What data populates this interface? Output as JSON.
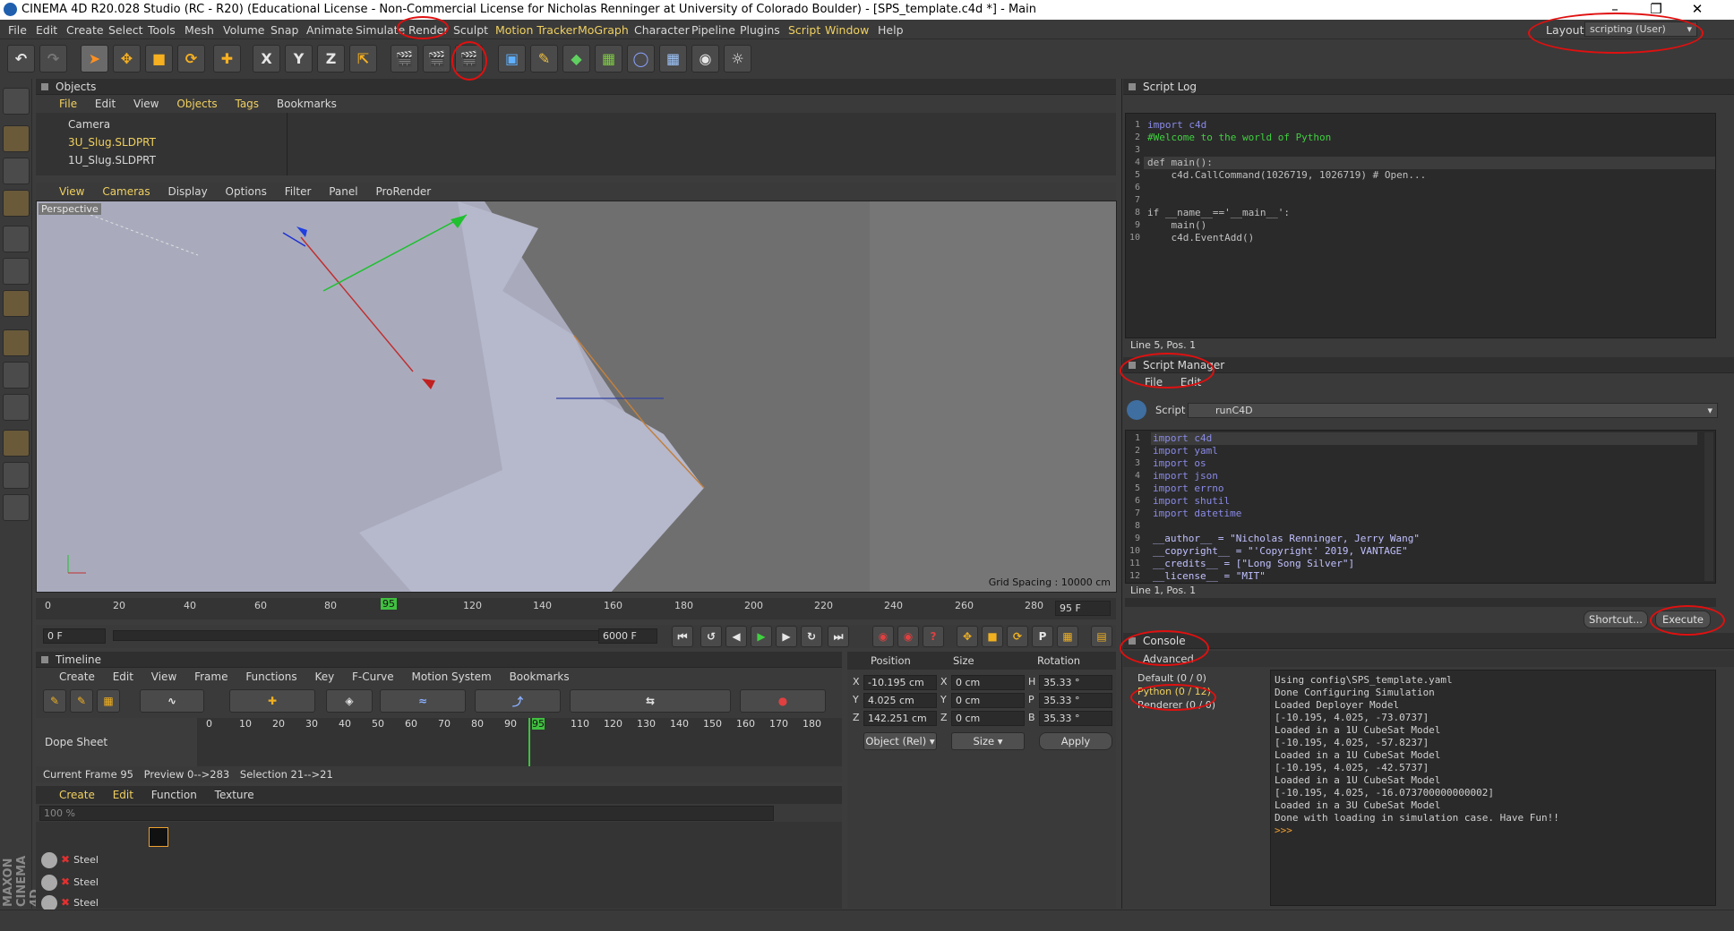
{
  "window": {
    "title": "CINEMA 4D R20.028 Studio (RC - R20) (Educational License - Non-Commercial License for Nicholas Renninger at University of Colorado Boulder) - [SPS_template.c4d *] - Main"
  },
  "menu": [
    "File",
    "Edit",
    "Create",
    "Select",
    "Tools",
    "Mesh",
    "Volume",
    "Snap",
    "Animate",
    "Simulate",
    "Render",
    "Sculpt",
    "Motion Tracker",
    "MoGraph",
    "Character",
    "Pipeline",
    "Plugins",
    "Script",
    "Window",
    "Help"
  ],
  "layout": {
    "label": "Layout:",
    "value": "scripting (User)"
  },
  "toolbar": {
    "x": "X",
    "y": "Y",
    "z": "Z"
  },
  "objects": {
    "title": "Objects",
    "menu": [
      "File",
      "Edit",
      "View",
      "Objects",
      "Tags",
      "Bookmarks"
    ],
    "items": [
      "Camera",
      "3U_Slug.SLDPRT",
      "1U_Slug.SLDPRT"
    ]
  },
  "viewport": {
    "menu": [
      "View",
      "Cameras",
      "Display",
      "Options",
      "Filter",
      "Panel",
      "ProRender"
    ],
    "label": "Perspective",
    "grid": "Grid Spacing : 10000 cm"
  },
  "timeline_ruler": {
    "ticks": [
      "0",
      "20",
      "40",
      "60",
      "80",
      "95",
      "120",
      "140",
      "160",
      "180",
      "200",
      "220",
      "240",
      "260",
      "280"
    ],
    "current": "95",
    "end": "95 F",
    "start_field": "0 F",
    "end_field": "6000 F"
  },
  "timeline": {
    "title": "Timeline",
    "menu": [
      "Create",
      "Edit",
      "View",
      "Frame",
      "Functions",
      "Key",
      "F-Curve",
      "Motion System",
      "Bookmarks"
    ],
    "dope": "Dope Sheet",
    "ticks": [
      "0",
      "10",
      "20",
      "30",
      "40",
      "50",
      "60",
      "70",
      "80",
      "90",
      "95",
      "110",
      "120",
      "130",
      "140",
      "150",
      "160",
      "170",
      "180"
    ],
    "status": {
      "current": "Current Frame  95",
      "preview": "Preview  0-->283",
      "selection": "Selection  21-->21"
    }
  },
  "materials": {
    "menu": [
      "Create",
      "Edit",
      "Function",
      "Texture"
    ],
    "zoom": "100 %",
    "items": [
      "Steel",
      "Steel",
      "Steel"
    ]
  },
  "coords": {
    "headers": [
      "Position",
      "Size",
      "Rotation"
    ],
    "rows": [
      {
        "axis": "X",
        "pos": "-10.195 cm",
        "sax": "X",
        "size": "0 cm",
        "rax": "H",
        "rot": "35.33 °"
      },
      {
        "axis": "Y",
        "pos": "4.025 cm",
        "sax": "Y",
        "size": "0 cm",
        "rax": "P",
        "rot": "35.33 °"
      },
      {
        "axis": "Z",
        "pos": "142.251 cm",
        "sax": "Z",
        "size": "0 cm",
        "rax": "B",
        "rot": "35.33 °"
      }
    ],
    "mode": "Object (Rel)",
    "sizemode": "Size",
    "apply": "Apply"
  },
  "scriptlog": {
    "title": "Script Log",
    "lines": [
      "import c4d",
      "#Welcome to the world of Python",
      "",
      "def main():",
      "    c4d.CallCommand(1026719, 1026719) # Open...",
      "",
      "",
      "if __name__=='__main__':",
      "    main()",
      "    c4d.EventAdd()"
    ],
    "status": "Line 5, Pos. 1"
  },
  "scriptmanager": {
    "title": "Script Manager",
    "menu": [
      "File",
      "Edit"
    ],
    "script_label": "Script",
    "script": "runC4D",
    "lines": [
      "import c4d",
      "import yaml",
      "import os",
      "import json",
      "import errno",
      "import shutil",
      "import datetime",
      "",
      "__author__ = \"Nicholas Renninger, Jerry Wang\"",
      "__copyright__ = \"'Copyright' 2019, VANTAGE\"",
      "__credits__ = [\"Long Song Silver\"]",
      "__license__ = \"MIT\""
    ],
    "status": "Line 1, Pos. 1",
    "shortcut": "Shortcut...",
    "execute": "Execute"
  },
  "console": {
    "title": "Console",
    "advanced": "Advanced",
    "tree": [
      "Default (0 / 0)",
      "Python (0 / 12)",
      "Renderer (0 / 0)"
    ],
    "lines": [
      "Using config\\SPS_template.yaml",
      "Done Configuring Simulation",
      "Loaded Deployer Model",
      "[-10.195, 4.025, -73.0737]",
      "Loaded in a 1U CubeSat Model",
      "[-10.195, 4.025, -57.8237]",
      "Loaded in a 1U CubeSat Model",
      "[-10.195, 4.025, -42.5737]",
      "Loaded in a 1U CubeSat Model",
      "[-10.195, 4.025, -16.073700000000002]",
      "Loaded in a 3U CubeSat Model",
      "Done with loading in simulation case. Have Fun!!",
      ">>>"
    ]
  },
  "brand": "MAXON CINEMA 4D"
}
